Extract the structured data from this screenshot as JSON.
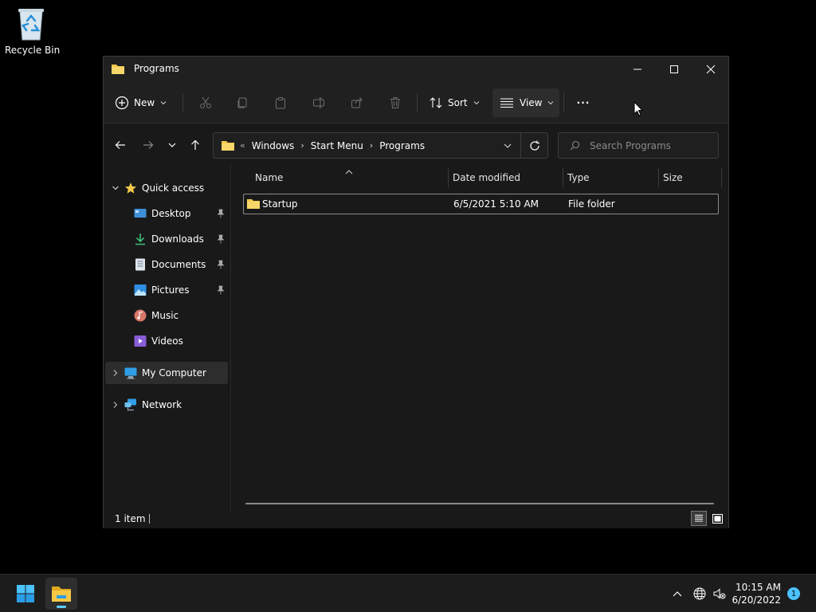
{
  "desktop": {
    "recycle_bin_label": "Recycle Bin"
  },
  "window": {
    "title": "Programs",
    "controls": {
      "minimize": "minimize",
      "maximize": "maximize",
      "close": "close"
    }
  },
  "toolbar": {
    "new_label": "New",
    "sort_label": "Sort",
    "view_label": "View",
    "more_label": "···"
  },
  "address": {
    "overflow": "«",
    "crumbs": [
      "Windows",
      "Start Menu",
      "Programs"
    ]
  },
  "search": {
    "placeholder": "Search Programs"
  },
  "sidebar": {
    "quick_access": "Quick access",
    "items": [
      {
        "label": "Desktop",
        "icon": "desktop-icon",
        "pinned": true
      },
      {
        "label": "Downloads",
        "icon": "download-icon",
        "pinned": true
      },
      {
        "label": "Documents",
        "icon": "document-icon",
        "pinned": true
      },
      {
        "label": "Pictures",
        "icon": "picture-icon",
        "pinned": true
      },
      {
        "label": "Music",
        "icon": "music-icon",
        "pinned": false
      },
      {
        "label": "Videos",
        "icon": "video-icon",
        "pinned": false
      }
    ],
    "my_computer": "My Computer",
    "network": "Network"
  },
  "columns": {
    "name": "Name",
    "date": "Date modified",
    "type": "Type",
    "size": "Size"
  },
  "files": [
    {
      "name": "Startup",
      "date": "6/5/2021 5:10 AM",
      "type": "File folder",
      "size": ""
    }
  ],
  "status": {
    "count": "1 item"
  },
  "taskbar": {
    "time": "10:15 AM",
    "date": "6/20/2022",
    "notifications": "1"
  },
  "colors": {
    "accent": "#60cdff",
    "folder": "#f2c94c",
    "window_bg": "#191919",
    "titlebar_bg": "#202020"
  }
}
